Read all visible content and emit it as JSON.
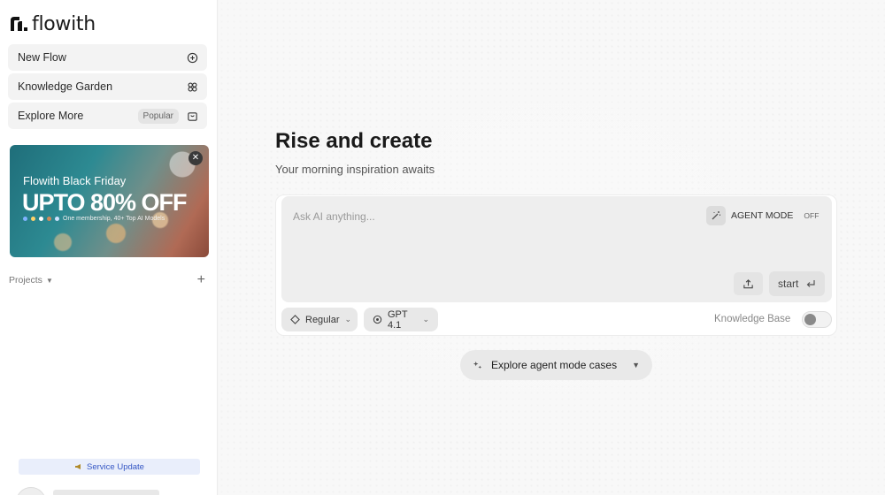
{
  "brand": {
    "name": "flowith"
  },
  "sidebar": {
    "items": [
      {
        "label": "New Flow",
        "icon": "new-flow-icon"
      },
      {
        "label": "Knowledge Garden",
        "icon": "garden-icon"
      },
      {
        "label": "Explore More",
        "badge": "Popular",
        "icon": "bag-icon"
      }
    ],
    "promo": {
      "title": "Flowith Black Friday",
      "headline": "UPTO 80% OFF",
      "subtitle": "One membership, 40+ Top AI Models"
    },
    "projects_label": "Projects",
    "service_update": "Service Update"
  },
  "main": {
    "title": "Rise and create",
    "subtitle": "Your morning inspiration awaits",
    "composer": {
      "placeholder": "Ask AI anything...",
      "agent_mode_label": "AGENT MODE",
      "agent_mode_state": "OFF",
      "start_label": "start",
      "mode_select": "Regular",
      "model_select": "GPT 4.1",
      "knowledge_base_label": "Knowledge Base",
      "knowledge_base_enabled": false
    },
    "explore_agent_label": "Explore agent mode cases"
  }
}
